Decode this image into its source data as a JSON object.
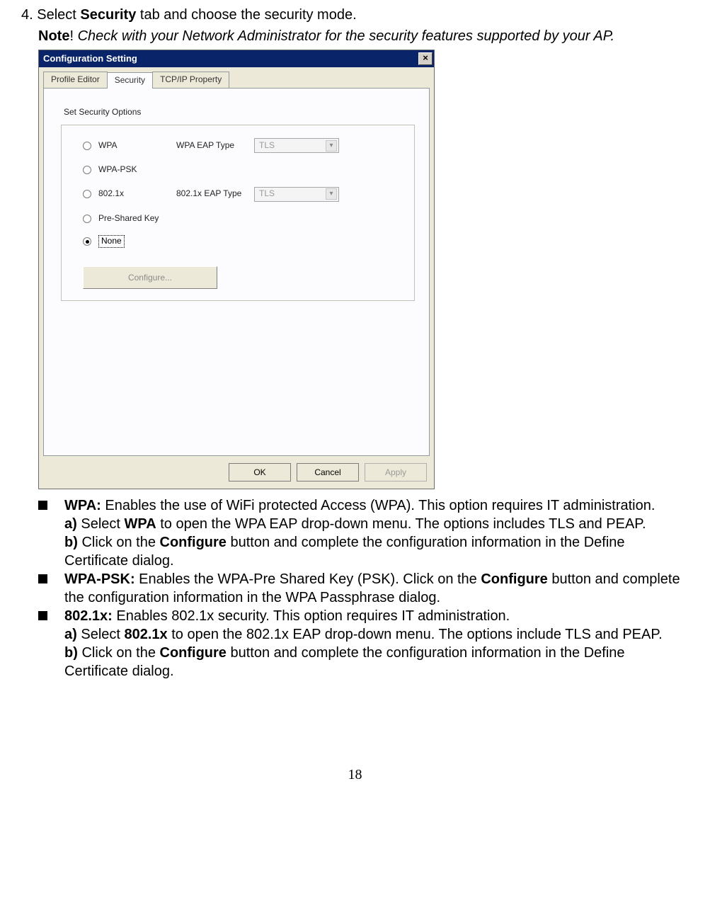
{
  "step_number": "4.",
  "step_instruction_prefix": "Select ",
  "step_instruction_bold": "Security",
  "step_instruction_suffix": " tab and choose the security mode.",
  "note_bold": "Note",
  "note_excl": "! ",
  "note_italic": "Check with your Network Administrator for the security features supported by your AP.",
  "dialog": {
    "title": "Configuration Setting",
    "close": "×",
    "tabs": {
      "t1": "Profile Editor",
      "t2": "Security",
      "t3": "TCP/IP Property"
    },
    "group_title": "Set Security Options",
    "opts": {
      "wpa": "WPA",
      "wpapsk": "WPA-PSK",
      "dot1x": "802.1x",
      "psk": "Pre-Shared Key",
      "none": "None"
    },
    "eap_labels": {
      "wpa": "WPA EAP Type",
      "dot1x": "802.1x EAP Type"
    },
    "eap_values": {
      "wpa": "TLS",
      "dot1x": "TLS"
    },
    "configure": "Configure...",
    "buttons": {
      "ok": "OK",
      "cancel": "Cancel",
      "apply": "Apply"
    }
  },
  "desc": {
    "wpa_bold": "WPA:",
    "wpa_text": " Enables the use of WiFi protected Access (WPA). This option requires IT administration.",
    "wpa_a_bold": "a)",
    "wpa_a_pre": " Select ",
    "wpa_a_strong": "WPA",
    "wpa_a_post": " to open the WPA EAP drop-down menu. The options includes TLS and PEAP.",
    "wpa_b_bold": "b)",
    "wpa_b_pre": " Click on the ",
    "wpa_b_strong": "Configure",
    "wpa_b_post": " button and complete the configuration information in the Define Certificate dialog.",
    "wpapsk_bold": "WPA-PSK:",
    "wpapsk_pre": " Enables the WPA-Pre Shared Key (PSK). Click on the ",
    "wpapsk_strong": "Configure",
    "wpapsk_post": " button and complete the configuration information in the WPA Passphrase dialog.",
    "dot1x_bold": "802.1x:",
    "dot1x_text": " Enables 802.1x security. This option requires IT administration.",
    "dot1x_a_bold": "a)",
    "dot1x_a_pre": " Select ",
    "dot1x_a_strong": "802.1x",
    "dot1x_a_post": " to open the 802.1x EAP drop-down menu. The options include TLS and PEAP.",
    "dot1x_b_bold": "b)",
    "dot1x_b_pre": " Click on the ",
    "dot1x_b_strong": "Configure",
    "dot1x_b_post": " button and complete the configuration information in the Define Certificate dialog."
  },
  "pagenum": "18"
}
